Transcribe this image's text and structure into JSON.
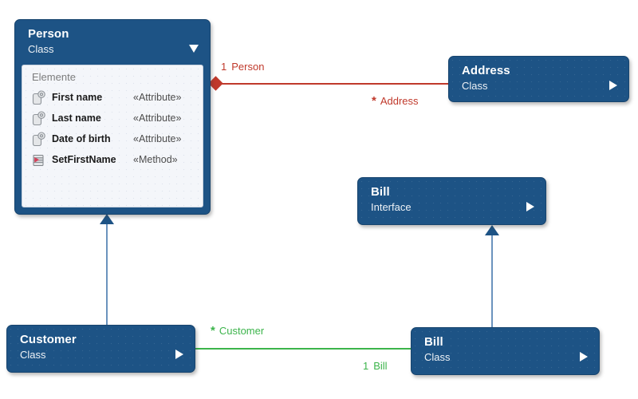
{
  "diagram": {
    "type": "uml-class-diagram",
    "background_color": "#ffffff",
    "node_color": "#1d5385",
    "node_body_color": "#f4f6fa"
  },
  "nodes": [
    {
      "id": "person",
      "title": "Person",
      "stereotype": "Class",
      "expanded": true,
      "toggle_icon": "chevron-down-icon",
      "body_label": "Elemente",
      "members": [
        {
          "name": "First name",
          "kind": "«Attribute»",
          "icon": "attribute-icon"
        },
        {
          "name": "Last name",
          "kind": "«Attribute»",
          "icon": "attribute-icon"
        },
        {
          "name": "Date of birth",
          "kind": "«Attribute»",
          "icon": "attribute-icon"
        },
        {
          "name": "SetFirstName",
          "kind": "«Method»",
          "icon": "method-icon"
        }
      ]
    },
    {
      "id": "address",
      "title": "Address",
      "stereotype": "Class",
      "expanded": false,
      "toggle_icon": "chevron-right-icon"
    },
    {
      "id": "bill_interface",
      "title": "Bill",
      "stereotype": "Interface",
      "expanded": false,
      "toggle_icon": "chevron-right-icon"
    },
    {
      "id": "customer",
      "title": "Customer",
      "stereotype": "Class",
      "expanded": false,
      "toggle_icon": "chevron-right-icon"
    },
    {
      "id": "bill_class",
      "title": "Bill",
      "stereotype": "Class",
      "expanded": false,
      "toggle_icon": "chevron-right-icon"
    }
  ],
  "edges": [
    {
      "id": "person_address",
      "kind": "composition",
      "color": "#c0392b",
      "source": "person",
      "target": "address",
      "source_label": {
        "multiplicity": "1",
        "role": "Person"
      },
      "target_label": {
        "multiplicity": "*",
        "role": "Address"
      }
    },
    {
      "id": "customer_bill",
      "kind": "association",
      "color": "#3cb44b",
      "source": "customer",
      "target": "bill_class",
      "source_label": {
        "multiplicity": "*",
        "role": "Customer"
      },
      "target_label": {
        "multiplicity": "1",
        "role": "Bill"
      }
    },
    {
      "id": "customer_person",
      "kind": "generalization",
      "color": "#6b93bd",
      "source": "customer",
      "target": "person"
    },
    {
      "id": "bill_billinterface",
      "kind": "realization",
      "color": "#6b93bd",
      "source": "bill_class",
      "target": "bill_interface"
    }
  ]
}
